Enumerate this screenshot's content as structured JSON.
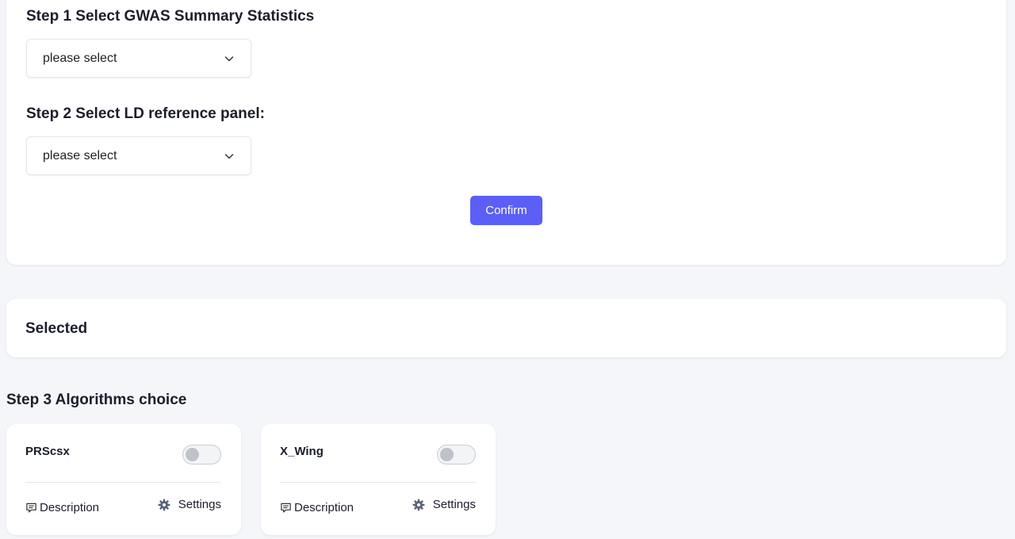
{
  "step1": {
    "title": "Step 1 Select GWAS Summary Statistics",
    "select_value": "please select"
  },
  "step2": {
    "title": "Step 2 Select LD reference panel:",
    "select_value": "please select"
  },
  "confirm_label": "Confirm",
  "selected": {
    "title": "Selected"
  },
  "step3": {
    "title": "Step 3 Algorithms choice",
    "algorithms": [
      {
        "name": "PRScsx",
        "enabled": false,
        "description_label": "Description",
        "settings_label": "Settings"
      },
      {
        "name": "X_Wing",
        "enabled": false,
        "description_label": "Description",
        "settings_label": "Settings"
      }
    ]
  },
  "colors": {
    "accent": "#5b5ff5",
    "background": "#f4f6f9",
    "card": "#ffffff",
    "toggle_off": "#bfc2c8"
  },
  "icons": {
    "select_chevron": "chevron-down-icon",
    "description": "message-icon",
    "settings": "gear-icon"
  }
}
